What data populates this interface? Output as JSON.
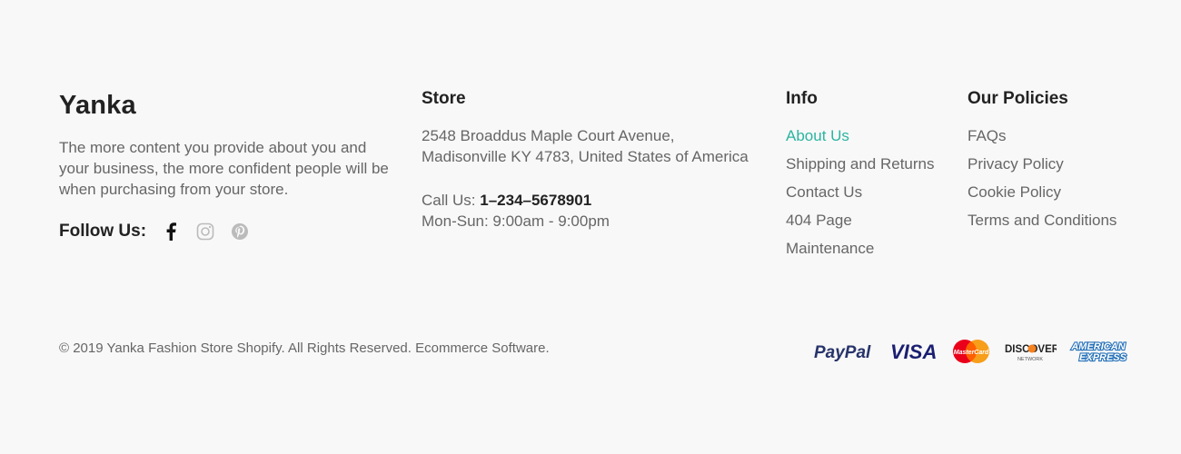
{
  "brand": {
    "name": "Yanka",
    "description": "The more content you provide about you and your business, the more confident people will be when purchasing from your store.",
    "follow_label": "Follow Us:",
    "social_icons": [
      "facebook-icon",
      "instagram-icon",
      "pinterest-icon"
    ]
  },
  "store": {
    "heading": "Store",
    "address_line1": "2548 Broaddus Maple Court Avenue,",
    "address_line2": "Madisonville KY 4783, United States of America",
    "call_label": "Call Us:",
    "phone": "1–234–5678901",
    "hours": "Mon-Sun: 9:00am - 9:00pm"
  },
  "info": {
    "heading": "Info",
    "items": [
      "About Us",
      "Shipping and Returns",
      "Contact Us",
      "404 Page",
      "Maintenance"
    ]
  },
  "policies": {
    "heading": "Our Policies",
    "items": [
      "FAQs",
      "Privacy Policy",
      "Cookie Policy",
      "Terms and Conditions"
    ]
  },
  "footer": {
    "copyright": "© 2019 Yanka Fashion Store Shopify. All Rights Reserved. Ecommerce Software."
  },
  "payments": {
    "paypal": "PayPal",
    "visa": "VISA",
    "mastercard": "MasterCard",
    "discover": "DISCOVER",
    "discover_sub": "NETWORK",
    "amex_line1": "AMERICAN",
    "amex_line2": "EXPRESS"
  },
  "colors": {
    "accent": "#2bb5a0",
    "heading": "#222222",
    "text": "#666666",
    "background": "#f8f8f8"
  }
}
